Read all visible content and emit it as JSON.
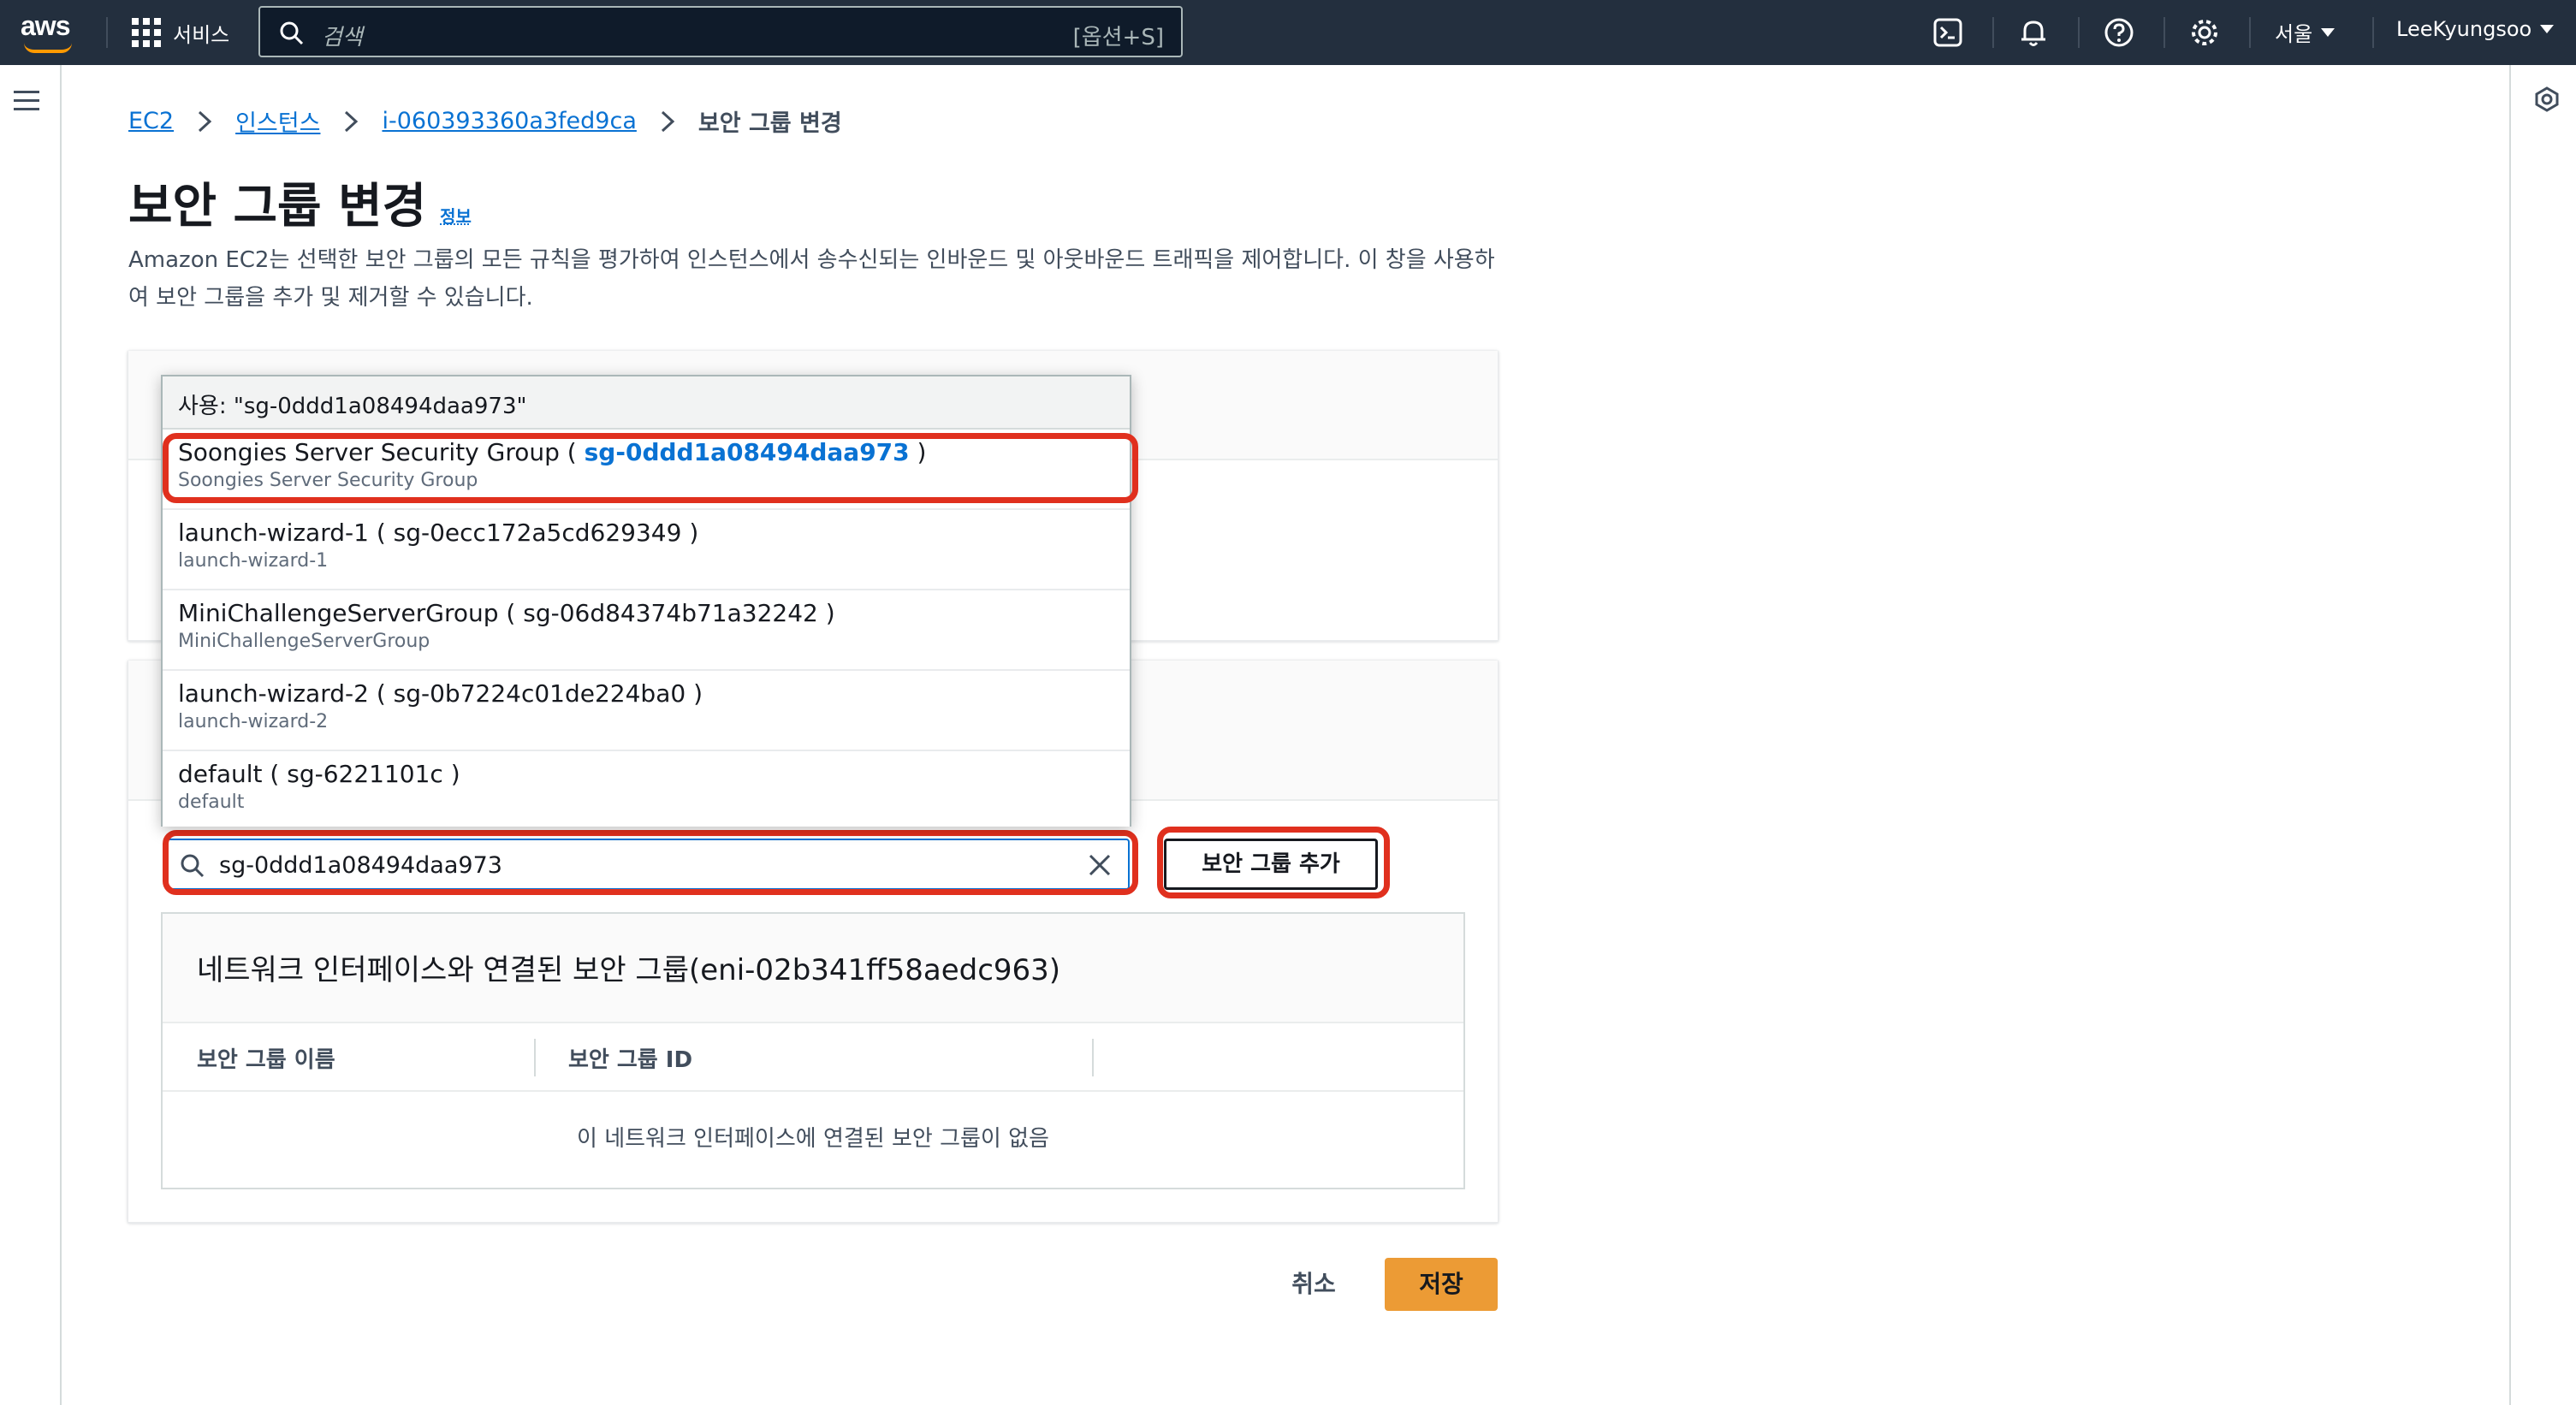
{
  "topnav": {
    "logo_text": "aws",
    "services_label": "서비스",
    "search_placeholder": "검색",
    "search_shortcut": "[옵션+S]",
    "region": "서울",
    "user": "LeeKyungsoo",
    "icons": [
      "cloudshell-icon",
      "bell-icon",
      "help-icon",
      "settings-icon"
    ]
  },
  "breadcrumb": {
    "items": [
      "EC2",
      "인스턴스",
      "i-060393360a3fed9ca"
    ],
    "current": "보안 그룹 변경"
  },
  "page": {
    "title": "보안 그룹 변경",
    "info": "정보",
    "description": "Amazon EC2는 선택한 보안 그룹의 모든 규칙을 평가하여 인스턴스에서 송수신되는 인바운드 및 아웃바운드 트래픽을 제어합니다. 이 창을 사용하여 보안 그룹을 추가 및 제거할 수 있습니다."
  },
  "dropdown": {
    "use_label": "사용: \"sg-0ddd1a08494daa973\"",
    "options": [
      {
        "name": "Soongies Server Security Group",
        "id": "sg-0ddd1a08494daa973",
        "sub": "Soongies Server Security Group"
      },
      {
        "name": "launch-wizard-1",
        "id": "sg-0ecc172a5cd629349",
        "sub": "launch-wizard-1"
      },
      {
        "name": "MiniChallengeServerGroup",
        "id": "sg-06d84374b71a32242",
        "sub": "MiniChallengeServerGroup"
      },
      {
        "name": "launch-wizard-2",
        "id": "sg-0b7224c01de224ba0",
        "sub": "launch-wizard-2"
      },
      {
        "name": "default",
        "id": "sg-6221101c",
        "sub": "default"
      }
    ]
  },
  "sg_search": {
    "value": "sg-0ddd1a08494daa973"
  },
  "add_button": "보안 그룹 추가",
  "table": {
    "title": "네트워크 인터페이스와 연결된 보안 그룹(eni-02b341ff58aedc963)",
    "columns": [
      "보안 그룹 이름",
      "보안 그룹 ID"
    ],
    "empty": "이 네트워크 인터페이스에 연결된 보안 그룹이 없음"
  },
  "footer": {
    "cancel": "취소",
    "save": "저장"
  },
  "colors": {
    "nav_bg": "#232f3e",
    "link": "#0972d3",
    "primary_button": "#ec9b35",
    "annotation_red": "#e0301e"
  }
}
